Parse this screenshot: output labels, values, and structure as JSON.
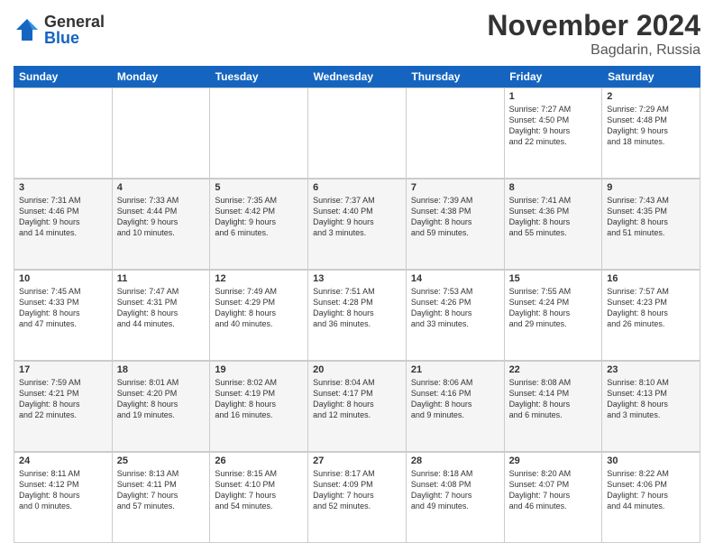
{
  "header": {
    "logo": {
      "general": "General",
      "blue": "Blue"
    },
    "title": "November 2024",
    "location": "Bagdarin, Russia"
  },
  "weekdays": [
    "Sunday",
    "Monday",
    "Tuesday",
    "Wednesday",
    "Thursday",
    "Friday",
    "Saturday"
  ],
  "weeks": [
    [
      {
        "day": "",
        "info": ""
      },
      {
        "day": "",
        "info": ""
      },
      {
        "day": "",
        "info": ""
      },
      {
        "day": "",
        "info": ""
      },
      {
        "day": "",
        "info": ""
      },
      {
        "day": "1",
        "info": "Sunrise: 7:27 AM\nSunset: 4:50 PM\nDaylight: 9 hours\nand 22 minutes."
      },
      {
        "day": "2",
        "info": "Sunrise: 7:29 AM\nSunset: 4:48 PM\nDaylight: 9 hours\nand 18 minutes."
      }
    ],
    [
      {
        "day": "3",
        "info": "Sunrise: 7:31 AM\nSunset: 4:46 PM\nDaylight: 9 hours\nand 14 minutes."
      },
      {
        "day": "4",
        "info": "Sunrise: 7:33 AM\nSunset: 4:44 PM\nDaylight: 9 hours\nand 10 minutes."
      },
      {
        "day": "5",
        "info": "Sunrise: 7:35 AM\nSunset: 4:42 PM\nDaylight: 9 hours\nand 6 minutes."
      },
      {
        "day": "6",
        "info": "Sunrise: 7:37 AM\nSunset: 4:40 PM\nDaylight: 9 hours\nand 3 minutes."
      },
      {
        "day": "7",
        "info": "Sunrise: 7:39 AM\nSunset: 4:38 PM\nDaylight: 8 hours\nand 59 minutes."
      },
      {
        "day": "8",
        "info": "Sunrise: 7:41 AM\nSunset: 4:36 PM\nDaylight: 8 hours\nand 55 minutes."
      },
      {
        "day": "9",
        "info": "Sunrise: 7:43 AM\nSunset: 4:35 PM\nDaylight: 8 hours\nand 51 minutes."
      }
    ],
    [
      {
        "day": "10",
        "info": "Sunrise: 7:45 AM\nSunset: 4:33 PM\nDaylight: 8 hours\nand 47 minutes."
      },
      {
        "day": "11",
        "info": "Sunrise: 7:47 AM\nSunset: 4:31 PM\nDaylight: 8 hours\nand 44 minutes."
      },
      {
        "day": "12",
        "info": "Sunrise: 7:49 AM\nSunset: 4:29 PM\nDaylight: 8 hours\nand 40 minutes."
      },
      {
        "day": "13",
        "info": "Sunrise: 7:51 AM\nSunset: 4:28 PM\nDaylight: 8 hours\nand 36 minutes."
      },
      {
        "day": "14",
        "info": "Sunrise: 7:53 AM\nSunset: 4:26 PM\nDaylight: 8 hours\nand 33 minutes."
      },
      {
        "day": "15",
        "info": "Sunrise: 7:55 AM\nSunset: 4:24 PM\nDaylight: 8 hours\nand 29 minutes."
      },
      {
        "day": "16",
        "info": "Sunrise: 7:57 AM\nSunset: 4:23 PM\nDaylight: 8 hours\nand 26 minutes."
      }
    ],
    [
      {
        "day": "17",
        "info": "Sunrise: 7:59 AM\nSunset: 4:21 PM\nDaylight: 8 hours\nand 22 minutes."
      },
      {
        "day": "18",
        "info": "Sunrise: 8:01 AM\nSunset: 4:20 PM\nDaylight: 8 hours\nand 19 minutes."
      },
      {
        "day": "19",
        "info": "Sunrise: 8:02 AM\nSunset: 4:19 PM\nDaylight: 8 hours\nand 16 minutes."
      },
      {
        "day": "20",
        "info": "Sunrise: 8:04 AM\nSunset: 4:17 PM\nDaylight: 8 hours\nand 12 minutes."
      },
      {
        "day": "21",
        "info": "Sunrise: 8:06 AM\nSunset: 4:16 PM\nDaylight: 8 hours\nand 9 minutes."
      },
      {
        "day": "22",
        "info": "Sunrise: 8:08 AM\nSunset: 4:14 PM\nDaylight: 8 hours\nand 6 minutes."
      },
      {
        "day": "23",
        "info": "Sunrise: 8:10 AM\nSunset: 4:13 PM\nDaylight: 8 hours\nand 3 minutes."
      }
    ],
    [
      {
        "day": "24",
        "info": "Sunrise: 8:11 AM\nSunset: 4:12 PM\nDaylight: 8 hours\nand 0 minutes."
      },
      {
        "day": "25",
        "info": "Sunrise: 8:13 AM\nSunset: 4:11 PM\nDaylight: 7 hours\nand 57 minutes."
      },
      {
        "day": "26",
        "info": "Sunrise: 8:15 AM\nSunset: 4:10 PM\nDaylight: 7 hours\nand 54 minutes."
      },
      {
        "day": "27",
        "info": "Sunrise: 8:17 AM\nSunset: 4:09 PM\nDaylight: 7 hours\nand 52 minutes."
      },
      {
        "day": "28",
        "info": "Sunrise: 8:18 AM\nSunset: 4:08 PM\nDaylight: 7 hours\nand 49 minutes."
      },
      {
        "day": "29",
        "info": "Sunrise: 8:20 AM\nSunset: 4:07 PM\nDaylight: 7 hours\nand 46 minutes."
      },
      {
        "day": "30",
        "info": "Sunrise: 8:22 AM\nSunset: 4:06 PM\nDaylight: 7 hours\nand 44 minutes."
      }
    ]
  ]
}
